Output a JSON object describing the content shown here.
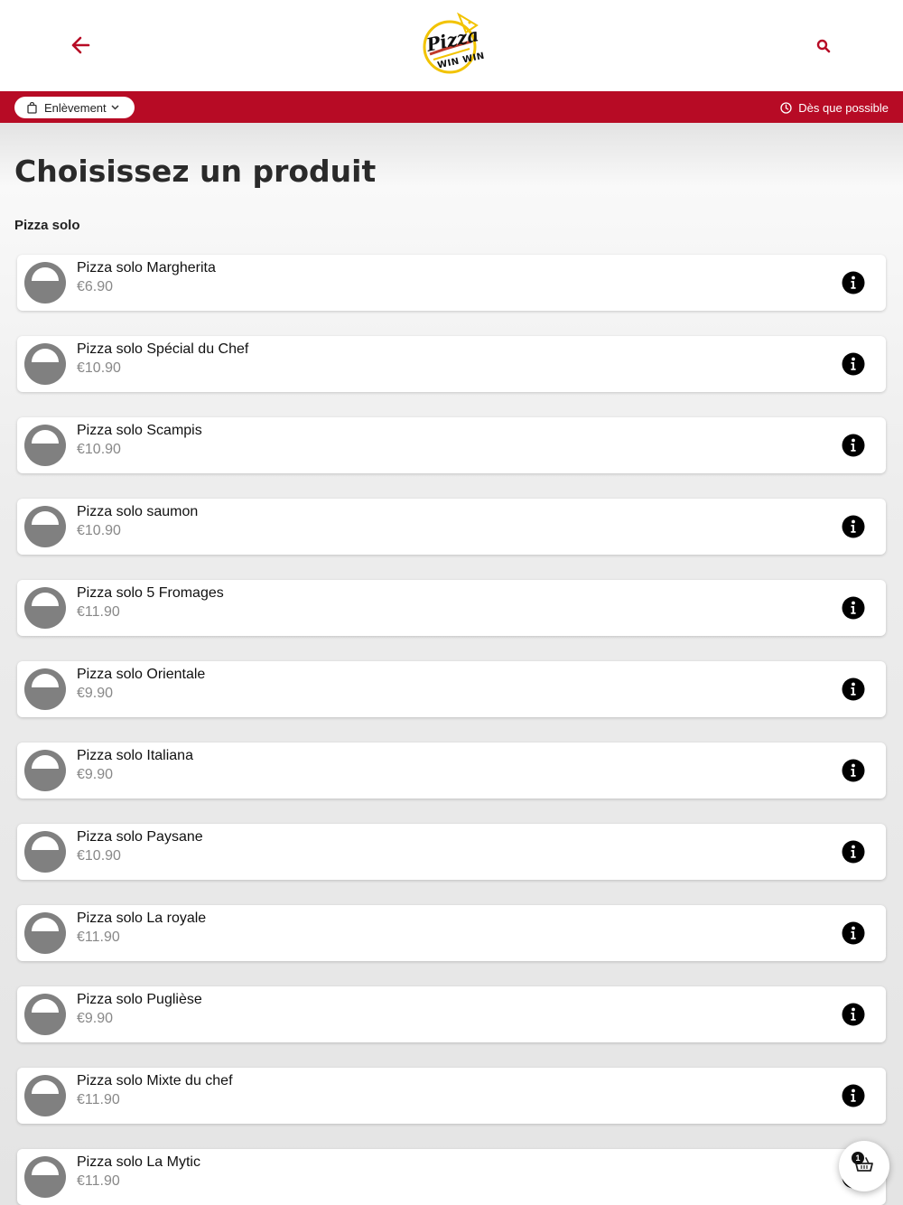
{
  "header": {
    "logo_text_1": "Pizza",
    "logo_text_2": "WIN WIN"
  },
  "bar": {
    "pickup_label": "Enlèvement",
    "timing_label": "Dès que possible"
  },
  "main": {
    "title": "Choisissez un produit",
    "section": "Pizza solo",
    "products": [
      {
        "name": "Pizza solo Margherita",
        "price": "€6.90"
      },
      {
        "name": "Pizza solo Spécial du Chef",
        "price": "€10.90"
      },
      {
        "name": "Pizza solo Scampis",
        "price": "€10.90"
      },
      {
        "name": "Pizza solo saumon",
        "price": "€10.90"
      },
      {
        "name": "Pizza solo 5 Fromages",
        "price": "€11.90"
      },
      {
        "name": "Pizza solo Orientale",
        "price": "€9.90"
      },
      {
        "name": "Pizza solo Italiana",
        "price": "€9.90"
      },
      {
        "name": "Pizza solo Paysane",
        "price": "€10.90"
      },
      {
        "name": "Pizza solo La royale",
        "price": "€11.90"
      },
      {
        "name": "Pizza solo Puglièse",
        "price": "€9.90"
      },
      {
        "name": "Pizza solo Mixte du chef",
        "price": "€11.90"
      },
      {
        "name": "Pizza solo La Mytic",
        "price": "€11.90"
      }
    ]
  },
  "cart": {
    "count": "1"
  },
  "colors": {
    "brand_red": "#b70b25",
    "thumb_gray": "#808080"
  },
  "icons": {
    "back": "arrow-left-icon",
    "search": "search-icon",
    "pickup": "shopping-bag-icon",
    "timing": "clock-icon",
    "info": "info-icon",
    "cart": "basket-icon"
  }
}
